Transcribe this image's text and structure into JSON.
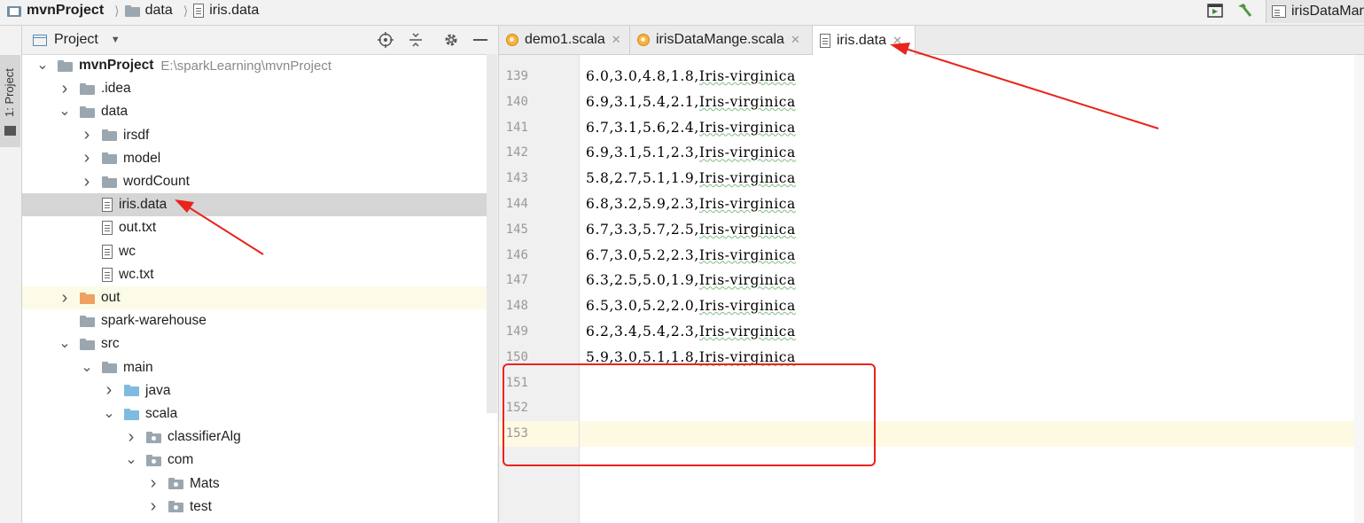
{
  "breadcrumb": [
    "mvnProject",
    "data",
    "iris.data"
  ],
  "run_config": "irisDataMange",
  "sidebar_stripe": {
    "label": "1: Project"
  },
  "project_panel": {
    "title": "Project",
    "tree": [
      {
        "label": "mvnProject",
        "path": "E:\\sparkLearning\\mvnProject",
        "depth": 0,
        "expanded": true,
        "kind": "module"
      },
      {
        "label": ".idea",
        "depth": 1,
        "expanded": false,
        "kind": "folder"
      },
      {
        "label": "data",
        "depth": 1,
        "expanded": true,
        "kind": "folder"
      },
      {
        "label": "irsdf",
        "depth": 2,
        "expanded": false,
        "kind": "folder"
      },
      {
        "label": "model",
        "depth": 2,
        "expanded": false,
        "kind": "folder"
      },
      {
        "label": "wordCount",
        "depth": 2,
        "expanded": false,
        "kind": "folder"
      },
      {
        "label": "iris.data",
        "depth": 2,
        "kind": "file",
        "selected": true
      },
      {
        "label": "out.txt",
        "depth": 2,
        "kind": "file"
      },
      {
        "label": "wc",
        "depth": 2,
        "kind": "file"
      },
      {
        "label": "wc.txt",
        "depth": 2,
        "kind": "file"
      },
      {
        "label": "out",
        "depth": 1,
        "expanded": false,
        "kind": "folder-excluded"
      },
      {
        "label": "spark-warehouse",
        "depth": 1,
        "kind": "folder"
      },
      {
        "label": "src",
        "depth": 1,
        "expanded": true,
        "kind": "folder"
      },
      {
        "label": "main",
        "depth": 2,
        "expanded": true,
        "kind": "folder"
      },
      {
        "label": "java",
        "depth": 3,
        "expanded": false,
        "kind": "folder-source"
      },
      {
        "label": "scala",
        "depth": 3,
        "expanded": true,
        "kind": "folder-source"
      },
      {
        "label": "classifierAlg",
        "depth": 4,
        "expanded": false,
        "kind": "package"
      },
      {
        "label": "com",
        "depth": 4,
        "expanded": true,
        "kind": "package"
      },
      {
        "label": "Mats",
        "depth": 5,
        "expanded": false,
        "kind": "package"
      },
      {
        "label": "test",
        "depth": 5,
        "expanded": false,
        "kind": "package"
      }
    ]
  },
  "editor": {
    "tabs": [
      {
        "label": "demo1.scala",
        "icon": "scala-object-icon",
        "active": false
      },
      {
        "label": "irisDataMange.scala",
        "icon": "scala-object-icon",
        "active": false
      },
      {
        "label": "iris.data",
        "icon": "text-file-icon",
        "active": true
      }
    ],
    "lines": [
      {
        "num": "139",
        "text": "6.0,3.0,4.8,1.8,",
        "tail": "Iris-virginica"
      },
      {
        "num": "140",
        "text": "6.9,3.1,5.4,2.1,",
        "tail": "Iris-virginica"
      },
      {
        "num": "141",
        "text": "6.7,3.1,5.6,2.4,",
        "tail": "Iris-virginica"
      },
      {
        "num": "142",
        "text": "6.9,3.1,5.1,2.3,",
        "tail": "Iris-virginica"
      },
      {
        "num": "143",
        "text": "5.8,2.7,5.1,1.9,",
        "tail": "Iris-virginica"
      },
      {
        "num": "144",
        "text": "6.8,3.2,5.9,2.3,",
        "tail": "Iris-virginica"
      },
      {
        "num": "145",
        "text": "6.7,3.3,5.7,2.5,",
        "tail": "Iris-virginica"
      },
      {
        "num": "146",
        "text": "6.7,3.0,5.2,2.3,",
        "tail": "Iris-virginica"
      },
      {
        "num": "147",
        "text": "6.3,2.5,5.0,1.9,",
        "tail": "Iris-virginica"
      },
      {
        "num": "148",
        "text": "6.5,3.0,5.2,2.0,",
        "tail": "Iris-virginica"
      },
      {
        "num": "149",
        "text": "6.2,3.4,5.4,2.3,",
        "tail": "Iris-virginica"
      },
      {
        "num": "150",
        "text": "5.9,3.0,5.1,1.8,",
        "tail": "Iris-virginica"
      },
      {
        "num": "151",
        "text": "",
        "tail": ""
      },
      {
        "num": "152",
        "text": "",
        "tail": ""
      },
      {
        "num": "153",
        "text": "",
        "tail": ""
      }
    ],
    "caret_line": "153"
  },
  "colors": {
    "annotation_red": "#e8241c",
    "selection": "#d5d5d5",
    "caret_row": "#fdf9e3"
  }
}
